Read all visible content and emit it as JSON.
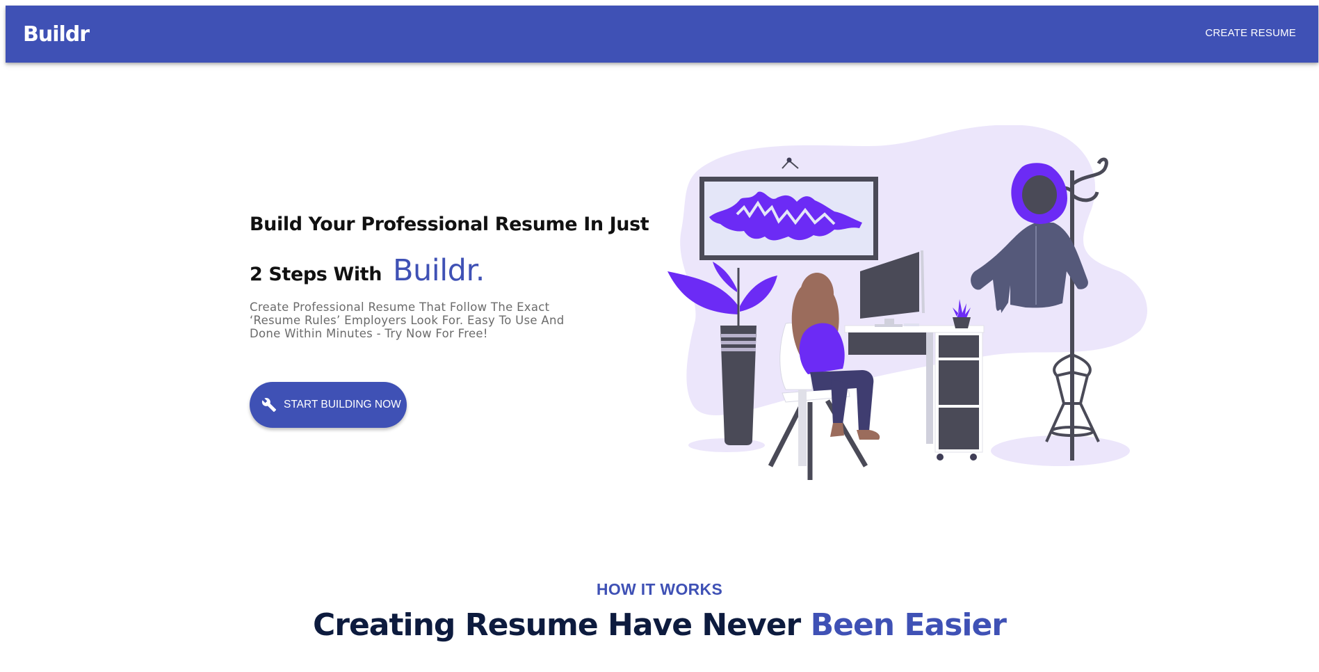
{
  "navbar": {
    "brand": "Buildr",
    "create_resume_label": "CREATE RESUME"
  },
  "hero": {
    "title_line1": "Build Your Professional Resume In Just",
    "title_line2": "2 Steps With",
    "title_brand": "Buildr.",
    "description": "Create Professional Resume That Follow The Exact ‘Resume Rules’ Employers Look For. Easy To Use And Done Within Minutes - Try Now For Free!",
    "cta_label": "START BUILDING NOW",
    "cta_icon": "wrench-icon"
  },
  "how_it_works": {
    "label": "HOW IT WORKS",
    "title_main": "Creating Resume Have Never",
    "title_accent": "Been Easier"
  },
  "colors": {
    "primary": "#3f51b5",
    "accent_purple": "#6c2bf5",
    "blob": "#ece6fb",
    "dark": "#0d1b3e"
  }
}
